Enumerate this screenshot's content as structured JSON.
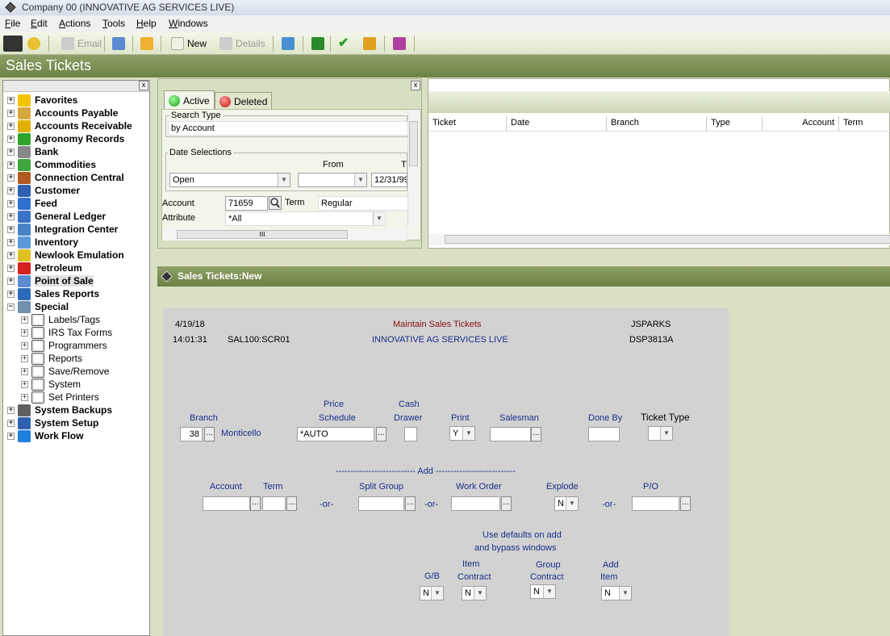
{
  "window": {
    "title": "Company 00 (INNOVATIVE AG SERVICES LIVE)"
  },
  "menu": [
    "File",
    "Edit",
    "Actions",
    "Tools",
    "Help",
    "Windows"
  ],
  "toolbar": {
    "email": "Email",
    "new": "New",
    "details": "Details"
  },
  "page_title": "Sales Tickets",
  "tree": {
    "close": "x",
    "items": [
      {
        "label": "Favorites",
        "color": "#f5c400"
      },
      {
        "label": "Accounts Payable",
        "color": "#d6a93c"
      },
      {
        "label": "Accounts Receivable",
        "color": "#e0b000"
      },
      {
        "label": "Agronomy Records",
        "color": "#2fa52f"
      },
      {
        "label": "Bank",
        "color": "#888888"
      },
      {
        "label": "Commodities",
        "color": "#3fa53f"
      },
      {
        "label": "Connection Central",
        "color": "#b05a20"
      },
      {
        "label": "Customer",
        "color": "#3060b0"
      },
      {
        "label": "Feed",
        "color": "#3070d0"
      },
      {
        "label": "General Ledger",
        "color": "#3a72c8"
      },
      {
        "label": "Integration Center",
        "color": "#4a82c8"
      },
      {
        "label": "Inventory",
        "color": "#5a9ad8"
      },
      {
        "label": "Newlook Emulation",
        "color": "#e0c020"
      },
      {
        "label": "Petroleum",
        "color": "#d82020"
      },
      {
        "label": "Point of Sale",
        "color": "#5a8ad0"
      },
      {
        "label": "Sales Reports",
        "color": "#2a6ab8"
      },
      {
        "label": "Special",
        "color": "#7090b0"
      }
    ],
    "special_children": [
      "Labels/Tags",
      "IRS Tax Forms",
      "Programmers",
      "Reports",
      "Save/Remove",
      "System",
      "Set Printers"
    ],
    "bottom_items": [
      {
        "label": "System Backups",
        "color": "#606060"
      },
      {
        "label": "System Setup",
        "color": "#3060b0"
      },
      {
        "label": "Work Flow",
        "color": "#2080e0"
      }
    ]
  },
  "search": {
    "close": "x",
    "tab_active": "Active",
    "tab_deleted": "Deleted",
    "search_type_label": "Search Type",
    "search_type_value": "by Account",
    "date_selections_label": "Date Selections",
    "from_label": "From",
    "to_label": "T",
    "date_mode": "Open",
    "to_value": "12/31/99",
    "account_label": "Account",
    "account_value": "71659",
    "term_label": "Term",
    "term_value": "Regular",
    "attribute_label": "Attribute",
    "attribute_value": "*All",
    "scroll_grip": "III"
  },
  "results": {
    "columns": [
      "Ticket",
      "Date",
      "Branch",
      "Type",
      "Account",
      "Term"
    ]
  },
  "subpanel_title": "Sales Tickets:New",
  "form": {
    "date": "4/19/18",
    "time": "14:01:31",
    "screen_id": "SAL100:SCR01",
    "heading": "Maintain Sales Tickets",
    "company": "INNOVATIVE AG SERVICES LIVE",
    "user": "JSPARKS",
    "display_id": "DSP3813A",
    "branch_label": "Branch",
    "branch_value": "38",
    "branch_name": "Monticello",
    "price_schedule_label_1": "Price",
    "price_schedule_label_2": "Schedule",
    "price_schedule_value": "*AUTO",
    "cash_drawer_label_1": "Cash",
    "cash_drawer_label_2": "Drawer",
    "print_label": "Print",
    "print_value": "Y",
    "salesman_label": "Salesman",
    "done_by_label": "Done By",
    "ticket_type_label": "Ticket Type",
    "add_divider": "--------------------------- Add ---------------------------",
    "account_label": "Account",
    "term_label": "Term",
    "split_group_label": "Split Group",
    "work_order_label": "Work Order",
    "explode_label": "Explode",
    "explode_value": "N",
    "po_label": "P/O",
    "or": "-or-",
    "defaults_1": "Use defaults on add",
    "defaults_2": "and bypass windows",
    "gb_label": "G/B",
    "gb_value": "N",
    "item_contract_1": "Item",
    "item_contract_2": "Contract",
    "item_contract_value": "N",
    "group_contract_1": "Group",
    "group_contract_2": "Contract",
    "group_contract_value": "N",
    "add_item_1": "Add",
    "add_item_2": "Item",
    "add_item_value": "N",
    "ellipsis": "..."
  }
}
